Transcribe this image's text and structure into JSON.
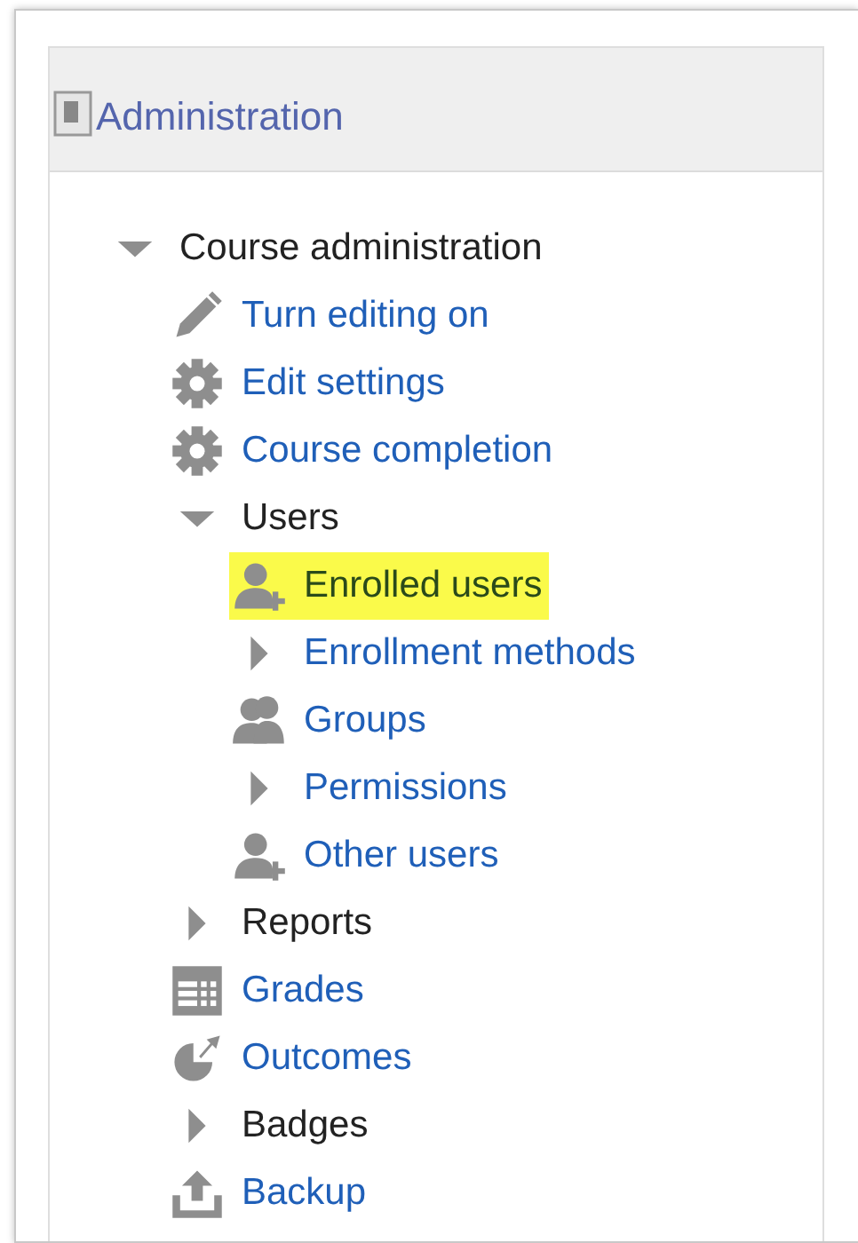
{
  "block": {
    "title": "Administration"
  },
  "tree": [
    {
      "kind": "branch",
      "label": "Course administration",
      "expanded": true,
      "selected": false,
      "link": false,
      "children": [
        {
          "kind": "edit",
          "label": "Turn editing on",
          "selected": false
        },
        {
          "kind": "settings",
          "label": "Edit settings",
          "selected": false
        },
        {
          "kind": "settings",
          "label": "Course completion",
          "selected": false
        },
        {
          "kind": "branch",
          "label": "Users",
          "expanded": true,
          "selected": false,
          "link": false,
          "children": [
            {
              "kind": "enrol",
              "label": "Enrolled users",
              "selected": true
            },
            {
              "kind": "branch",
              "label": "Enrollment methods",
              "expanded": false,
              "selected": false,
              "link": true
            },
            {
              "kind": "groups",
              "label": "Groups",
              "selected": false
            },
            {
              "kind": "branch",
              "label": "Permissions",
              "expanded": false,
              "selected": false,
              "link": true
            },
            {
              "kind": "enrol",
              "label": "Other users",
              "selected": false
            }
          ]
        },
        {
          "kind": "branch",
          "label": "Reports",
          "expanded": false,
          "selected": false,
          "link": false
        },
        {
          "kind": "grades",
          "label": "Grades",
          "selected": false
        },
        {
          "kind": "outcomes",
          "label": "Outcomes",
          "selected": false
        },
        {
          "kind": "branch",
          "label": "Badges",
          "expanded": false,
          "selected": false,
          "link": false
        },
        {
          "kind": "backup",
          "label": "Backup",
          "selected": false
        }
      ]
    }
  ]
}
